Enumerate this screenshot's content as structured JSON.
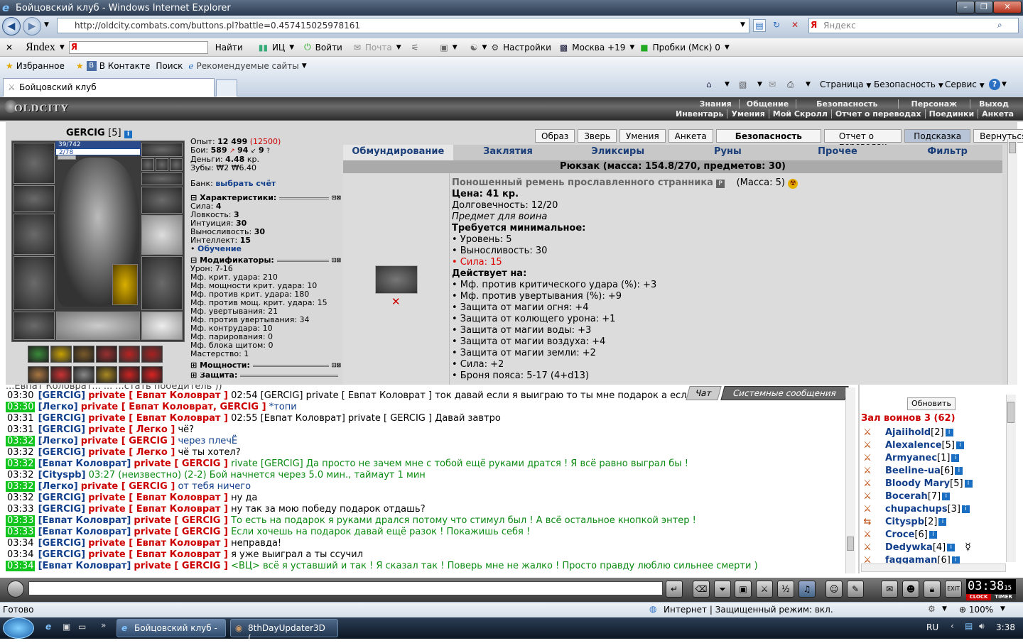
{
  "window": {
    "title": "Бойцовский клуб - Windows Internet Explorer"
  },
  "browser": {
    "url": "http://oldcity.combats.com/buttons.pl?battle=0.457415025978161",
    "search_placeholder": "Яндекс"
  },
  "yandex": {
    "logo": "Яndex",
    "find": "Найти",
    "ic": "ИЦ",
    "login": "Войти",
    "mail": "Почта",
    "settings": "Настройки",
    "weather": "Москва +19",
    "traffic": "Пробки (Мск) 0"
  },
  "favorites": {
    "fav": "Избранное",
    "vk": "В Контакте",
    "search": "Поиск",
    "recommended": "Рекомендуемые сайты"
  },
  "tab": {
    "title": "Бойцовский клуб"
  },
  "tools": {
    "page": "Страница",
    "security": "Безопасность",
    "service": "Сервис"
  },
  "game": {
    "logo": "OLDCITY",
    "topmenu": [
      "Знания",
      "Общение",
      "Безопасность",
      "Персонаж",
      "Выход"
    ],
    "submenu": [
      "Инвентарь",
      "Умения",
      "Мой Скролл",
      "Отчет о переводах",
      "Поединки",
      "Анкета"
    ]
  },
  "character": {
    "name": "GERCIG",
    "level": "[5]",
    "hp": "39/742",
    "mp": "2/78",
    "exp": "Опыт:",
    "exp_val": "12 499",
    "exp_next": "(12500)",
    "fights": "Бои:",
    "fights_win": "589",
    "fights_lose": "94",
    "fights_draw": "9",
    "money": "Деньги:",
    "money_val": "4.48",
    "money_unit": "кр.",
    "teeth": "Зубы:",
    "teeth_val": "₩2 ₩6.40",
    "bank": "Банк:",
    "bank_link": "выбрать счёт"
  },
  "stats": {
    "head": "Характеристики:",
    "rows": [
      [
        "Сила:",
        "4"
      ],
      [
        "Ловкость:",
        "3"
      ],
      [
        "Интуиция:",
        "30"
      ],
      [
        "Выносливость:",
        "30"
      ],
      [
        "Интеллект:",
        "15"
      ]
    ],
    "learn": "Обучение",
    "mod_head": "Модификаторы:",
    "mods": [
      "Урон: 7-16",
      "Мф. крит. удара: 210",
      "Мф. мощности крит. удара: 10",
      "Мф. против крит. удара: 180",
      "Мф. против мощ. крит. удара: 15",
      "Мф. увертывания: 21",
      "Мф. против увертывания: 34",
      "Мф. контрудара: 10",
      "Мф. парирования: 0",
      "Мф. блока щитом: 0",
      "Мастерство: 1"
    ],
    "power_head": "Мощности:",
    "defense_head": "Защита:"
  },
  "buttons": [
    "Образ",
    "Зверь",
    "Умения",
    "Анкета",
    "Безопасность",
    "Отчет о переводах",
    "Подсказка",
    "Вернуться"
  ],
  "tabs": [
    "Обмундирование",
    "Заклятия",
    "Эликсиры",
    "Руны",
    "Прочее",
    "Фильтр"
  ],
  "backpack": "Рюкзак (масса: 154.8/270, предметов: 30)",
  "item": {
    "name": "Поношенный ремень прославленного странника",
    "mass": "(Масса: 5)",
    "badge": "P",
    "price": "Цена: 41 кр.",
    "durability": "Долговечность: 12/20",
    "for": "Предмет для воина",
    "req_head": "Требуется минимальное:",
    "reqs": [
      "• Уровень: 5",
      "• Выносливость: 30"
    ],
    "req_fail": "• Сила: 15",
    "acts_head": "Действует на:",
    "acts": [
      "• Мф. против критического удара (%): +3",
      "• Мф. против увертывания (%): +9",
      "• Защита от магии огня: +4",
      "• Защита от колющего урона: +1",
      "• Защита от магии воды: +3",
      "• Защита от магии воздуха: +4",
      "• Защита от магии земли: +2",
      "• Сила: +2",
      "• Броня пояса: 5-17 (4+d13)"
    ]
  },
  "chat": {
    "tab_chat": "Чат",
    "tab_sys": "Системные сообщения",
    "top_partial": "...Евпат Коловрат... ... ...стать победитель ))",
    "lines": [
      {
        "t": "03:30",
        "g": false,
        "who": "[GERCIG]",
        "to": "private [ Евпат Коловрат ]",
        "msg": "02:54 [GERCIG] private [ Евпат Коловрат ] ток давай если я выиграю то ты мне подарок а есл",
        "c": ""
      },
      {
        "t": "03:30",
        "g": true,
        "who": "[Легко]",
        "to": "private [ Евпат Коловрат, GERCIG ]",
        "msg": "*топи",
        "c": "blue"
      },
      {
        "t": "03:31",
        "g": false,
        "who": "[GERCIG]",
        "to": "private [ Евпат Коловрат ]",
        "msg": "02:55 [Евпат Коловрат] private [ GERCIG ] Давай завтро",
        "c": ""
      },
      {
        "t": "03:31",
        "g": false,
        "who": "[GERCIG]",
        "to": "private [ Легко ]",
        "msg": "чё?",
        "c": ""
      },
      {
        "t": "03:32",
        "g": true,
        "who": "[Легко]",
        "to": "private [ GERCIG ]",
        "msg": "через плечЁ",
        "c": "blue"
      },
      {
        "t": "03:32",
        "g": false,
        "who": "[GERCIG]",
        "to": "private [ Легко ]",
        "msg": "чё ты хотел?",
        "c": ""
      },
      {
        "t": "03:32",
        "g": true,
        "who": "[Евпат Коловрат]",
        "to": "private [ GERCIG ]",
        "msg": "rivate [GERCIG] Да просто не зачем мне с тобой ещё руками дратся ! Я всё равно выграл бы !",
        "c": "green"
      },
      {
        "t": "03:32",
        "g": false,
        "who": "[Cityspb]",
        "to": "",
        "msg": "03:27 (неизвестно) (2-2) Бой начнется через 5.0 мин., таймаут 1 мин",
        "c": "green"
      },
      {
        "t": "03:32",
        "g": true,
        "who": "[Легко]",
        "to": "private [ GERCIG ]",
        "msg": "от тебя ничего",
        "c": "blue"
      },
      {
        "t": "03:32",
        "g": false,
        "who": "[GERCIG]",
        "to": "private [ Евпат Коловрат ]",
        "msg": "ну да",
        "c": ""
      },
      {
        "t": "03:33",
        "g": false,
        "who": "[GERCIG]",
        "to": "private [ Евпат Коловрат ]",
        "msg": "ну так за мою победу подарок отдашь?",
        "c": ""
      },
      {
        "t": "03:33",
        "g": true,
        "who": "[Евпат Коловрат]",
        "to": "private [ GERCIG ]",
        "msg": "То есть на подарок я руками дрался потому что стимул был ! А всё остальное кнопкой энтер !",
        "c": "green"
      },
      {
        "t": "03:33",
        "g": true,
        "who": "[Евпат Коловрат]",
        "to": "private [ GERCIG ]",
        "msg": "Если хочешь на подарок давай ещё разок ! Покажишь себя !",
        "c": "green"
      },
      {
        "t": "03:34",
        "g": false,
        "who": "[GERCIG]",
        "to": "private [ Евпат Коловрат ]",
        "msg": "неправда!",
        "c": ""
      },
      {
        "t": "03:34",
        "g": false,
        "who": "[GERCIG]",
        "to": "private [ Евпат Коловрат ]",
        "msg": "я уже выиграл а ты ссучил",
        "c": ""
      },
      {
        "t": "03:34",
        "g": true,
        "who": "[Евпат Коловрат]",
        "to": "private [ GERCIG ]",
        "msg": "<ВЦ> всё я уставший и так ! Я сказал так ! Поверь мне не жалко ! Просто правду люблю сильнее смерти )",
        "c": "green-i"
      }
    ]
  },
  "roster": {
    "refresh": "Обновить",
    "hall": "Зал воинов 3 (62)",
    "players": [
      [
        "Ajaiihold",
        "[2]"
      ],
      [
        "Alexalence",
        "[5]"
      ],
      [
        "Armyanec",
        "[1]"
      ],
      [
        "Beeline-ua",
        "[6]"
      ],
      [
        "Bloody Mary",
        "[5]"
      ],
      [
        "Bocerah",
        "[7]"
      ],
      [
        "chupachups",
        "[3]"
      ],
      [
        "Cityspb",
        "[2]"
      ],
      [
        "Croce",
        "[6]"
      ],
      [
        "Dedywka",
        "[4]"
      ],
      [
        "faggaman",
        "[6]"
      ]
    ]
  },
  "clock": {
    "time": "03:38",
    "sec": "15",
    "clock": "CLOCK",
    "timer": "TIMER"
  },
  "status": {
    "ready": "Готово",
    "zone": "Интернет | Защищенный режим: вкл.",
    "zoom": "100%"
  },
  "taskbar": {
    "task1": "Бойцовский клуб - ...",
    "task2": "8thDayUpdater3D (...",
    "lang": "RU",
    "time": "3:38"
  }
}
